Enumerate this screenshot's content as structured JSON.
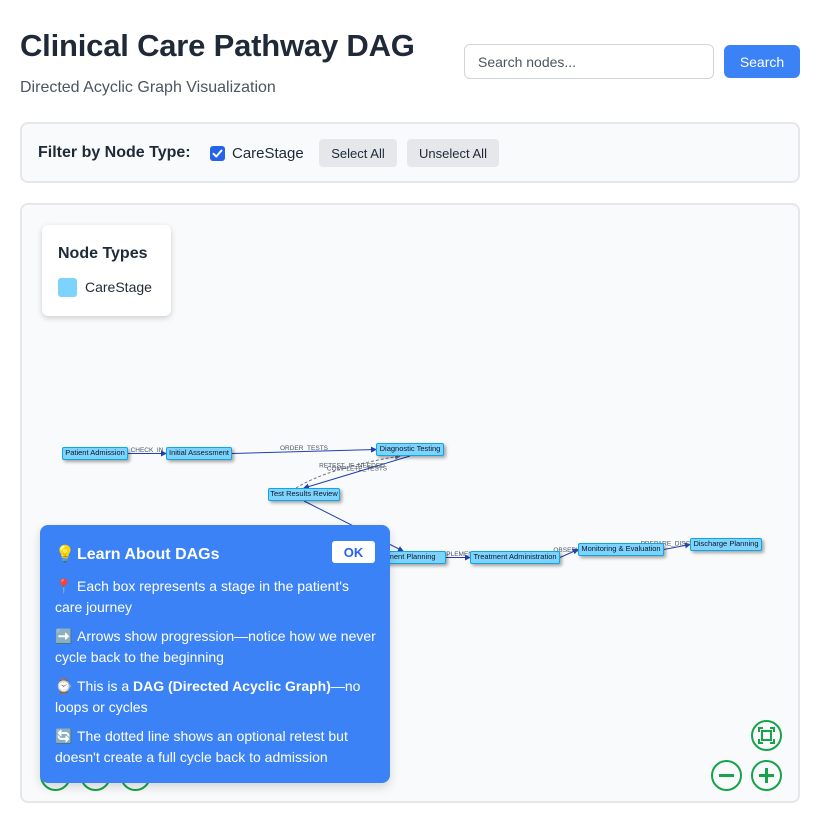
{
  "header": {
    "title": "Clinical Care Pathway DAG",
    "subtitle": "Directed Acyclic Graph Visualization",
    "search_placeholder": "Search nodes...",
    "search_button": "Search"
  },
  "filter": {
    "label": "Filter by Node Type:",
    "types": [
      {
        "label": "CareStage",
        "checked": true
      }
    ],
    "select_all": "Select All",
    "unselect_all": "Unselect All"
  },
  "legend": {
    "title": "Node Types",
    "items": [
      {
        "label": "CareStage",
        "color": "#7dd3fc"
      }
    ]
  },
  "graph": {
    "nodes": [
      {
        "id": "patient_admission",
        "label": "Patient Admission"
      },
      {
        "id": "initial_assessment",
        "label": "Initial Assessment"
      },
      {
        "id": "diagnostic_testing",
        "label": "Diagnostic Testing"
      },
      {
        "id": "test_results_review",
        "label": "Test Results Review"
      },
      {
        "id": "treatment_planning",
        "label": "Treatment Planning"
      },
      {
        "id": "treatment_administration",
        "label": "Treatment Administration"
      },
      {
        "id": "monitoring_evaluation",
        "label": "Monitoring & Evaluation"
      },
      {
        "id": "discharge_planning",
        "label": "Discharge Planning"
      }
    ],
    "edges": [
      {
        "from": "patient_admission",
        "to": "initial_assessment",
        "label": "CHECK_IN"
      },
      {
        "from": "initial_assessment",
        "to": "diagnostic_testing",
        "label": "ORDER_TESTS"
      },
      {
        "from": "diagnostic_testing",
        "to": "test_results_review",
        "label": "COMPLETE_TESTS"
      },
      {
        "from": "test_results_review",
        "to": "diagnostic_testing",
        "label": "RETEST_IF_NEEDED",
        "dashed": true
      },
      {
        "from": "test_results_review",
        "to": "treatment_planning",
        "label": ""
      },
      {
        "from": "treatment_planning",
        "to": "treatment_administration",
        "label": "IMPLEMENT"
      },
      {
        "from": "treatment_administration",
        "to": "monitoring_evaluation",
        "label": "OBSERVE"
      },
      {
        "from": "monitoring_evaluation",
        "to": "discharge_planning",
        "label": "PREPARE_DISCHARGE"
      }
    ],
    "node_color": "#7dd3fc",
    "edge_color": "#1e40af"
  },
  "controls": {
    "fit_icon": "fit-screen-icon",
    "zoom_out_icon": "zoom-out-icon",
    "zoom_in_icon": "zoom-in-icon",
    "color": "#16a34a"
  },
  "tooltip": {
    "title": "Learn About DAGs",
    "title_icon": "💡",
    "ok": "OK",
    "items": [
      {
        "icon": "📍",
        "text": "Each box represents a stage in the patient's care journey"
      },
      {
        "icon": "➡️",
        "text_parts": [
          "Arrows show progression—notice how we never cycle back to the beginning"
        ]
      },
      {
        "icon": "⌚",
        "pre": "This is a ",
        "bold": "DAG (Directed Acyclic Graph)",
        "post": "—no loops or cycles"
      },
      {
        "icon": "🔄",
        "text": "The dotted line shows an optional retest but doesn't create a full cycle back to admission"
      }
    ]
  }
}
